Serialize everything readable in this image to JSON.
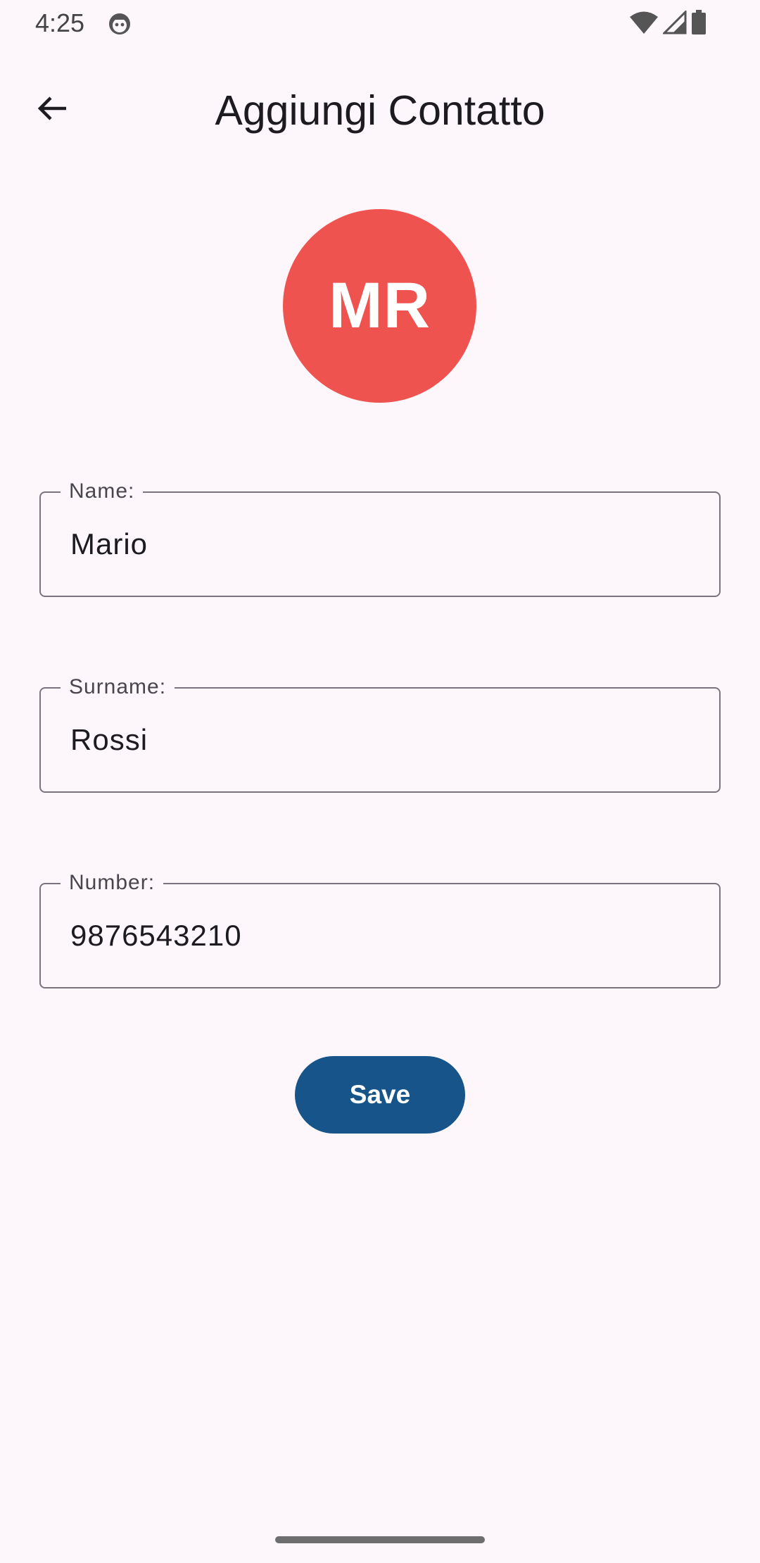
{
  "status_bar": {
    "time": "4:25",
    "icons": [
      "debug-icon",
      "wifi-icon",
      "cell-signal-icon",
      "battery-icon"
    ]
  },
  "app_bar": {
    "title": "Aggiungi Contatto",
    "back_icon": "arrow-back-icon"
  },
  "avatar": {
    "initials": "MR",
    "color": "#EF5350"
  },
  "form": {
    "name": {
      "label": "Name:",
      "value": "Mario"
    },
    "surname": {
      "label": "Surname:",
      "value": "Rossi"
    },
    "number": {
      "label": "Number:",
      "value": "9876543210"
    }
  },
  "actions": {
    "save_label": "Save",
    "save_color": "#175489"
  },
  "colors": {
    "background": "#FDF7FC",
    "outline": "#79747E"
  }
}
